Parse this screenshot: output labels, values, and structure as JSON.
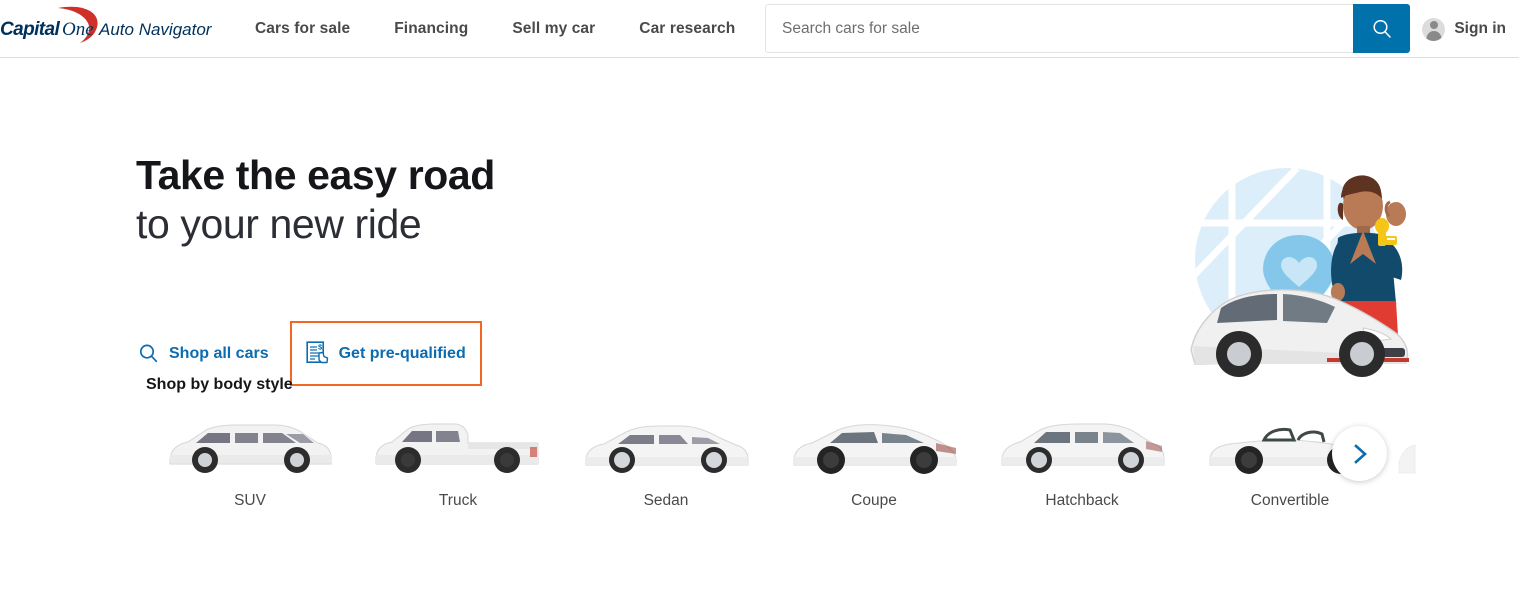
{
  "header": {
    "logo": {
      "brand_bold": "Capital",
      "brand_light": "One",
      "product": "Auto Navigator",
      "brand_color": "#003b5c",
      "swoosh_color": "#d03027"
    },
    "nav": [
      {
        "label": "Cars for sale",
        "name": "nav-cars-for-sale"
      },
      {
        "label": "Financing",
        "name": "nav-financing"
      },
      {
        "label": "Sell my car",
        "name": "nav-sell-my-car"
      },
      {
        "label": "Car research",
        "name": "nav-car-research"
      }
    ],
    "search": {
      "placeholder": "Search cars for sale",
      "value": "",
      "button_icon": "search-icon",
      "button_color": "#0071ab"
    },
    "account": {
      "label": "Sign in",
      "icon": "user-avatar-icon"
    }
  },
  "hero": {
    "title_line1": "Take the easy road",
    "title_line2": "to your new ride",
    "cta_primary": {
      "label": "Shop all cars",
      "icon": "search-icon"
    },
    "cta_secondary": {
      "label": "Get pre-qualified",
      "icon": "document-dollar-icon",
      "focus_ring_color": "#f26722"
    },
    "illustration": {
      "name": "woman-with-keys-and-car-illustration",
      "map_circle_color": "#d9edfa",
      "pin_color": "#84c7ea",
      "jacket_color": "#114a6b",
      "skirt_color": "#e03c31"
    }
  },
  "body_style": {
    "heading": "Shop by body style",
    "items": [
      {
        "label": "SUV",
        "image": "suv-side-profile"
      },
      {
        "label": "Truck",
        "image": "truck-side-profile"
      },
      {
        "label": "Sedan",
        "image": "sedan-side-profile"
      },
      {
        "label": "Coupe",
        "image": "coupe-side-profile"
      },
      {
        "label": "Hatchback",
        "image": "hatchback-side-profile"
      },
      {
        "label": "Convertible",
        "image": "convertible-side-profile"
      }
    ],
    "next_button_icon": "chevron-right-icon",
    "accent_color": "#0b6cb0"
  }
}
